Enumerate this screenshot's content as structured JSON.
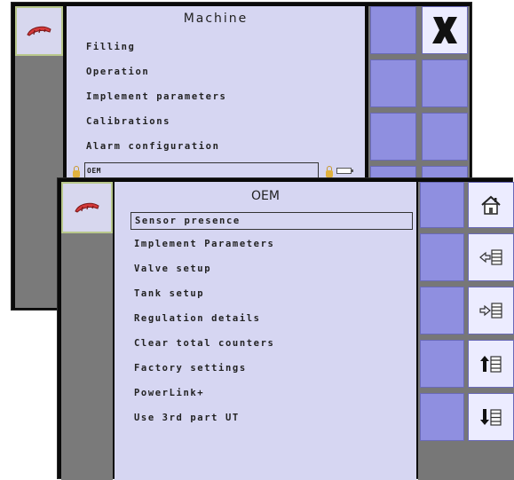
{
  "back_screen": {
    "title": "Machine",
    "items": [
      "Filling",
      "Operation",
      "Implement parameters",
      "Calibrations",
      "Alarm configuration",
      "OEM"
    ],
    "close_icon": "close-icon",
    "logo_icon": "machine-logo-icon"
  },
  "front_screen": {
    "title": "OEM",
    "items": [
      "Sensor presence",
      "Implement Parameters",
      "Valve setup",
      "Tank setup",
      "Regulation details",
      "Clear total counters",
      "Factory settings",
      "PowerLink+",
      "Use 3rd part UT"
    ],
    "selected_item": "Sensor presence",
    "softkeys": [
      {
        "name": "home",
        "icon": "home-icon"
      },
      {
        "name": "previous-page",
        "icon": "arrow-left-list-icon"
      },
      {
        "name": "next-page",
        "icon": "arrow-right-list-icon"
      },
      {
        "name": "scroll-up",
        "icon": "arrow-up-list-icon"
      },
      {
        "name": "scroll-down",
        "icon": "arrow-down-list-icon"
      }
    ]
  },
  "colors": {
    "panel": "#d6d6f2",
    "softkey": "#8f8fe0",
    "softkey_active": "#ececff",
    "frame": "#0a0a0a",
    "side": "#777777"
  }
}
